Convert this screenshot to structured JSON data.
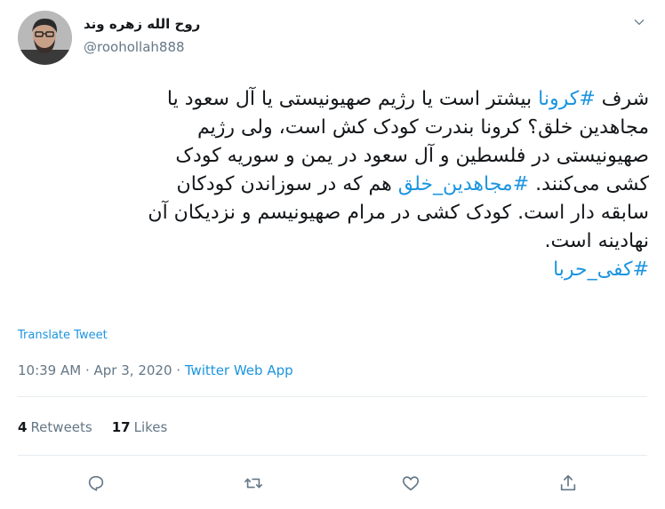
{
  "author": {
    "display_name": "روح الله زهره وند",
    "handle": "@roohollah888"
  },
  "tweet": {
    "lines": [
      [
        {
          "text": "شرف "
        },
        {
          "text": "#کرونا",
          "hashtag": true
        },
        {
          "text": " بیشتر است یا رژیم صهیونیستی یا آل سعود یا"
        }
      ],
      [
        {
          "text": "مجاهدین خلق؟ کرونا بندرت کودک کش است، ولی رژیم"
        }
      ],
      [
        {
          "text": "صهیونیستی در فلسطین و آل سعود در یمن و سوریه کودک"
        }
      ],
      [
        {
          "text": "کشی می‌کنند. "
        },
        {
          "text": "#مجاهدین_خلق",
          "hashtag": true
        },
        {
          "text": " هم که در سوزاندن کودکان"
        }
      ],
      [
        {
          "text": "سابقه دار است. کودک کشی در مرام صهیونیسم و نزدیکان آن"
        }
      ],
      [
        {
          "text": "نهادینه است."
        }
      ],
      [
        {
          "text": "#کفی_حربا",
          "hashtag": true
        }
      ]
    ]
  },
  "translate_label": "Translate Tweet",
  "meta": {
    "time": "10:39 AM",
    "separator": " · ",
    "date": "Apr 3, 2020",
    "source": "Twitter Web App"
  },
  "stats": {
    "retweets_count": "4",
    "retweets_label": "Retweets",
    "likes_count": "17",
    "likes_label": "Likes"
  },
  "colors": {
    "link": "#1b95e0",
    "muted": "#657786",
    "text": "#14171a",
    "divider": "#e6ecf0"
  },
  "icons": [
    "chevron-down-icon",
    "reply-icon",
    "retweet-icon",
    "like-icon",
    "share-icon"
  ]
}
